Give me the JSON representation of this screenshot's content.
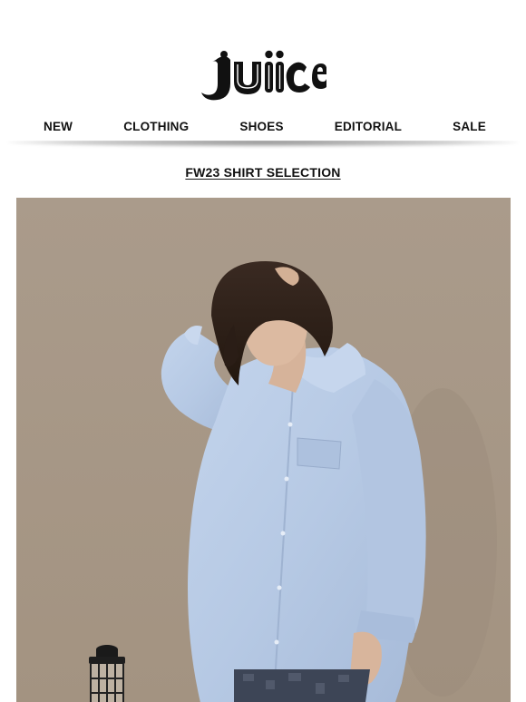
{
  "brand": {
    "name": "juice",
    "logo_icon": "juice-wordmark-logo"
  },
  "nav": {
    "items": [
      {
        "label": "NEW"
      },
      {
        "label": "CLOTHING"
      },
      {
        "label": "SHOES"
      },
      {
        "label": "EDITORIAL"
      },
      {
        "label": "SALE"
      }
    ]
  },
  "section": {
    "title": "FW23 SHIRT SELECTION"
  },
  "hero": {
    "image_subject": "model-in-light-blue-oxford-shirt",
    "background_color": "#a99a8a",
    "shirt_color": "#b7cbe6"
  },
  "colors": {
    "text": "#111111",
    "background": "#ffffff"
  }
}
